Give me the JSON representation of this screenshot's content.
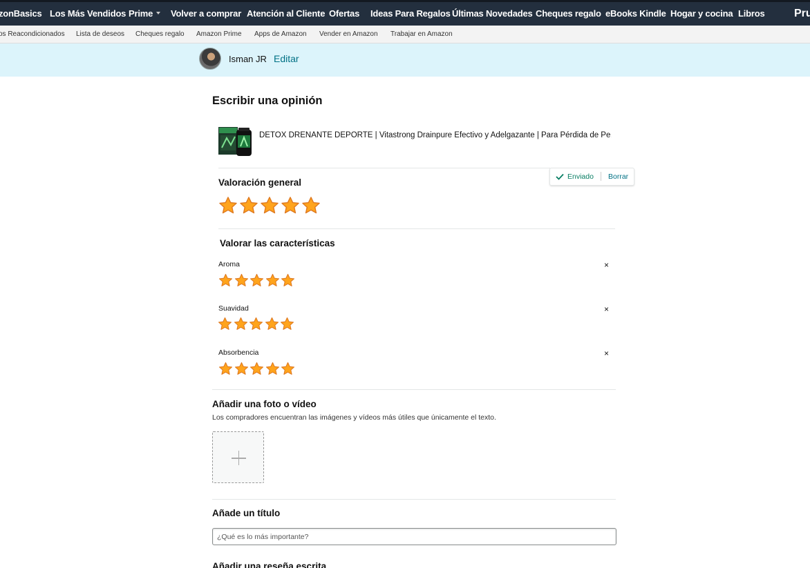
{
  "nav": {
    "main_items": [
      "zonBasics",
      "Los Más Vendidos",
      "Prime",
      "Volver a comprar",
      "Atención al Cliente",
      "Ofertas",
      "Ideas Para Regalos",
      "Últimas Novedades",
      "Cheques regalo",
      "eBooks Kindle",
      "Hogar y cocina",
      "Libros"
    ],
    "right_text": "Pru",
    "sub_items": [
      "os Reacondicionados",
      "Lista de deseos",
      "Cheques regalo",
      "Amazon Prime",
      "Apps de Amazon",
      "Vender en Amazon",
      "Trabajar en Amazon"
    ]
  },
  "profile": {
    "name": "Isman JR",
    "edit_label": "Editar"
  },
  "page_title": "Escribir una opinión",
  "product": {
    "title": "DETOX DRENANTE DEPORTE | Vitastrong Drainpure Efectivo y Adelgazante | Para Pérdida de Pe…"
  },
  "overall": {
    "title": "Valoración general",
    "rating": 5,
    "max": 5,
    "status_sent": "Enviado",
    "status_delete": "Borrar"
  },
  "features": {
    "title": "Valorar las características",
    "items": [
      {
        "label": "Aroma",
        "rating": 5
      },
      {
        "label": "Suavidad",
        "rating": 5
      },
      {
        "label": "Absorbencia",
        "rating": 5
      }
    ],
    "close_glyph": "×"
  },
  "media": {
    "title": "Añadir una foto o vídeo",
    "helper": "Los compradores encuentran las imágenes y vídeos más útiles que únicamente el texto."
  },
  "review_title": {
    "title": "Añade un título",
    "placeholder": "¿Qué es lo más importante?"
  },
  "written_review": {
    "title": "Añadir una reseña escrita"
  },
  "colors": {
    "nav_bg": "#232f3e",
    "profile_bg": "#dcf4fb",
    "link": "#007185",
    "success": "#067d62",
    "star_fill": "#ffa41c",
    "star_stroke": "#de7921"
  },
  "icons": {
    "status_check": "check-icon",
    "close": "close-icon",
    "upload": "plus-icon",
    "star": "star-icon",
    "caret": "caret-down-icon"
  }
}
